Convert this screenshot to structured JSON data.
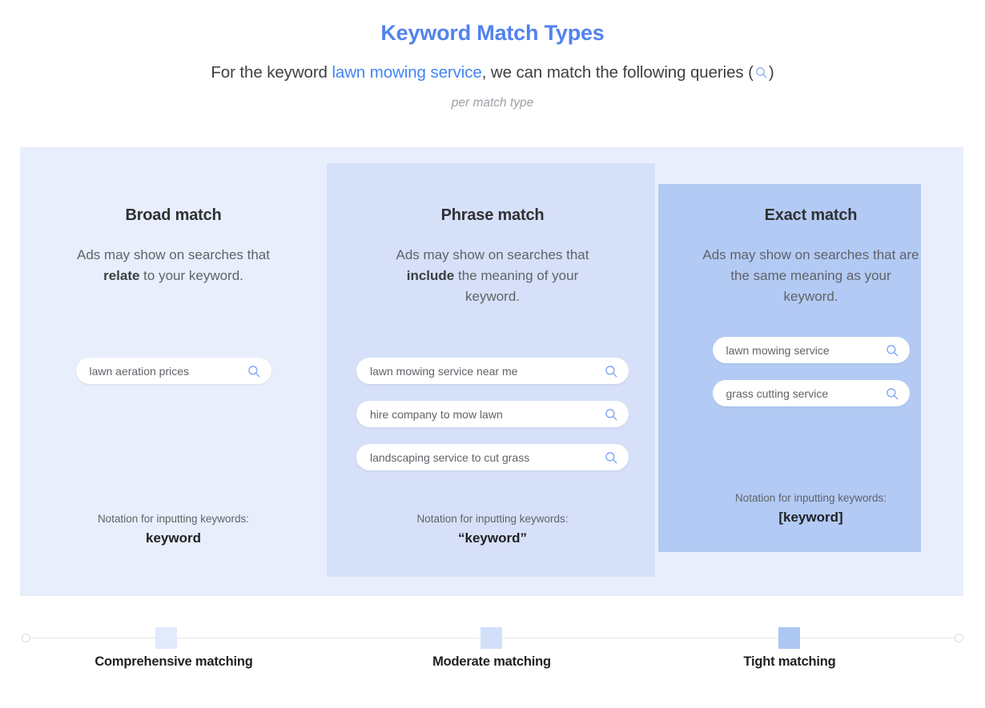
{
  "header": {
    "title": "Keyword Match Types",
    "subtitle_pre": "For the keyword ",
    "subtitle_keyword": "lawn mowing service",
    "subtitle_post": ", we can match the following queries (",
    "subtitle_close": ")",
    "sub_note": "per match type",
    "title_color": "#5282ef",
    "keyword_color": "#4285f4"
  },
  "columns": [
    {
      "id": "broad",
      "heading": "Broad match",
      "desc_pre": "Ads may show on searches that ",
      "desc_bold": "relate",
      "desc_post": " to your keyword.",
      "queries": [
        {
          "text": "lawn aeration prices",
          "icon": "search-icon"
        }
      ],
      "notation_label": "Notation for inputting keywords:",
      "notation_value": "keyword",
      "bg": "#e8eefc"
    },
    {
      "id": "phrase",
      "heading": "Phrase match",
      "desc_pre": "Ads may show on searches that ",
      "desc_bold": "include",
      "desc_post": " the meaning of your keyword.",
      "queries": [
        {
          "text": "lawn mowing service near me",
          "icon": "search-icon"
        },
        {
          "text": "hire company to mow lawn",
          "icon": "search-icon"
        },
        {
          "text": "landscaping service to cut grass",
          "icon": "search-icon"
        }
      ],
      "notation_label": "Notation for inputting keywords:",
      "notation_value": "“keyword”",
      "bg": "#d6e0f8"
    },
    {
      "id": "exact",
      "heading": "Exact match",
      "desc_pre": "Ads may show on searches that are the same meaning as your keyword.",
      "desc_bold": "",
      "desc_post": "",
      "queries": [
        {
          "text": "lawn mowing service",
          "icon": "search-icon"
        },
        {
          "text": "grass cutting service",
          "icon": "search-icon"
        }
      ],
      "notation_label": "Notation for inputting keywords:",
      "notation_value": "[keyword]",
      "bg": "#b3caf4"
    }
  ],
  "scale": {
    "markers": [
      {
        "label": "Comprehensive matching",
        "color": "#e2eafc"
      },
      {
        "label": "Moderate matching",
        "color": "#d2dffa"
      },
      {
        "label": "Tight matching",
        "color": "#adc7f3"
      }
    ]
  }
}
